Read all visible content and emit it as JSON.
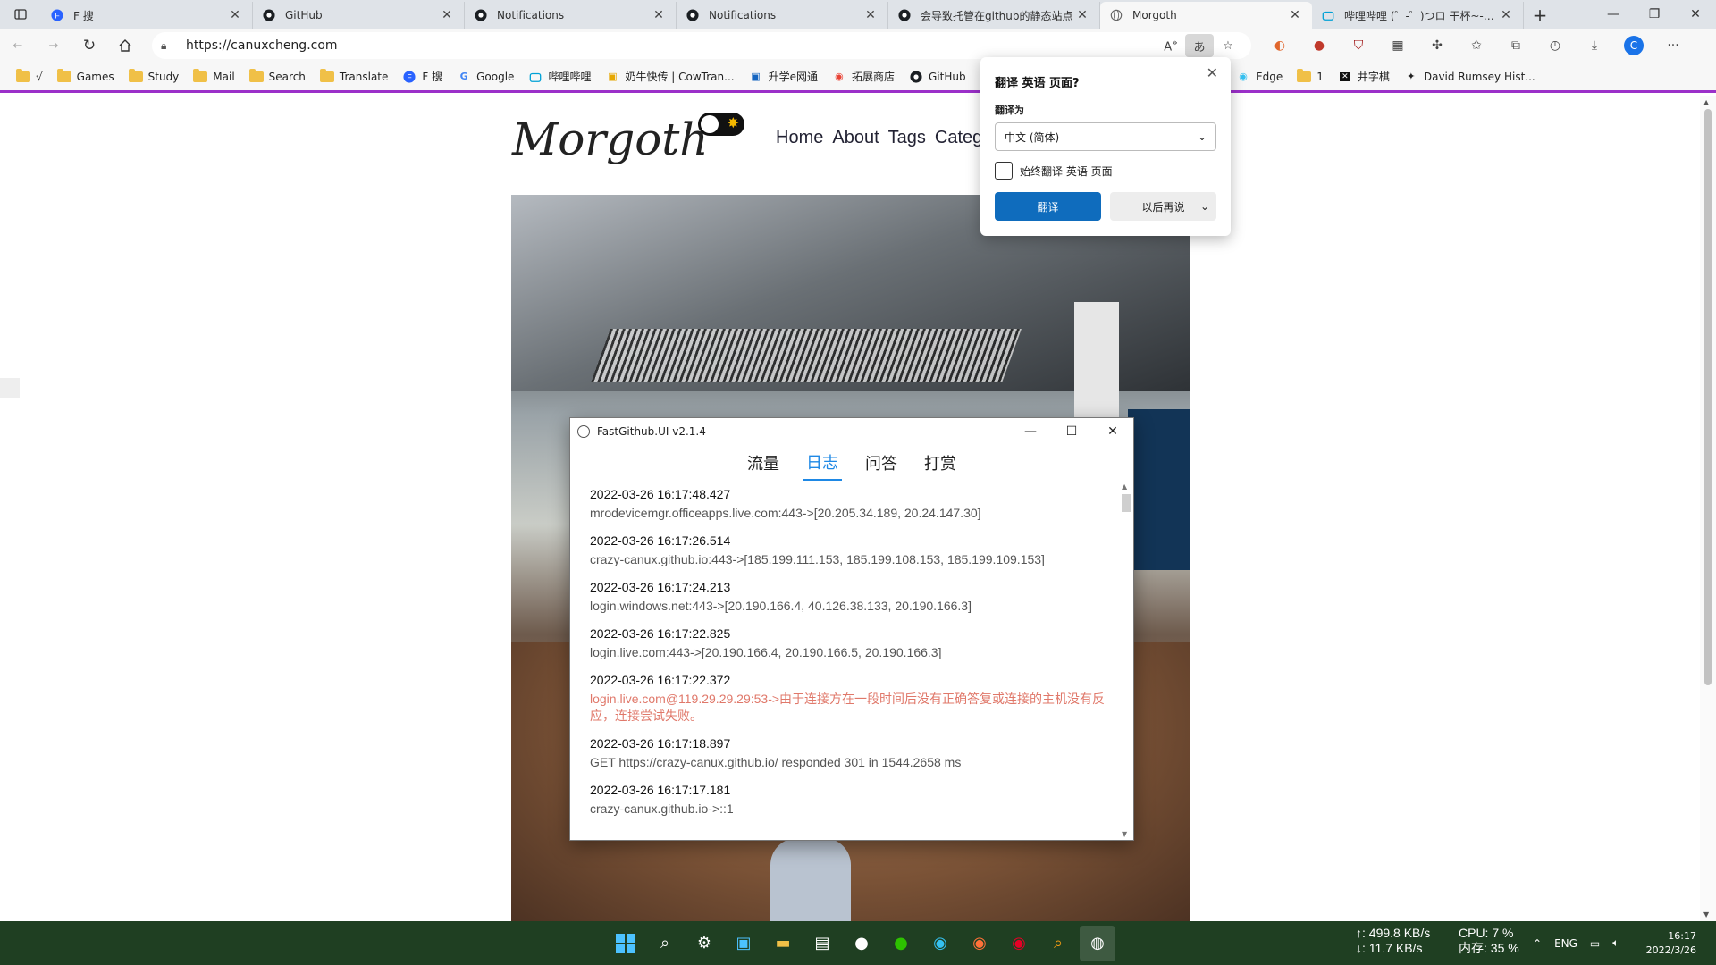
{
  "browser": {
    "tabs": [
      {
        "label": "F 搜",
        "icon": "f-search-icon",
        "active": false
      },
      {
        "label": "GitHub",
        "icon": "github-icon",
        "active": false
      },
      {
        "label": "Notifications",
        "icon": "github-icon",
        "active": false
      },
      {
        "label": "Notifications",
        "icon": "github-icon",
        "active": false
      },
      {
        "label": "会导致托管在github的静态站点",
        "icon": "github-icon",
        "active": false
      },
      {
        "label": "Morgoth",
        "icon": "globe-icon",
        "active": true
      },
      {
        "label": "哔哩哔哩 (゜-゜)つロ 干杯~-bili",
        "icon": "bilibili-icon",
        "active": false
      }
    ],
    "url": "https://canuxcheng.com",
    "bookmarks": [
      {
        "label": "√",
        "icon": "folder-icon"
      },
      {
        "label": "Games",
        "icon": "folder-icon"
      },
      {
        "label": "Study",
        "icon": "folder-icon"
      },
      {
        "label": "Mail",
        "icon": "folder-icon"
      },
      {
        "label": "Search",
        "icon": "folder-icon"
      },
      {
        "label": "Translate",
        "icon": "folder-icon"
      },
      {
        "label": "F 搜",
        "icon": "f-search-icon"
      },
      {
        "label": "Google",
        "icon": "google-icon"
      },
      {
        "label": "哔哩哔哩",
        "icon": "bilibili-icon"
      },
      {
        "label": "奶牛快传 | CowTran...",
        "icon": "cow-icon"
      },
      {
        "label": "升学e网通",
        "icon": "e-icon"
      },
      {
        "label": "拓展商店",
        "icon": "store-icon"
      },
      {
        "label": "GitHub",
        "icon": "github-icon"
      }
    ],
    "bookmarks_right": [
      {
        "label": "Edge",
        "icon": "edge-icon"
      },
      {
        "label": "1",
        "icon": "folder-icon"
      },
      {
        "label": "井字棋",
        "icon": "x-icon"
      },
      {
        "label": "David Rumsey Hist...",
        "icon": "star-icon"
      }
    ]
  },
  "site": {
    "logo": "Morgoth",
    "nav": [
      "Home",
      "About",
      "Tags",
      "Categ"
    ]
  },
  "translate_popup": {
    "title": "翻译 英语 页面?",
    "target_label": "翻译为",
    "target_value": "中文 (简体)",
    "always_label": "始终翻译 英语 页面",
    "translate_button": "翻译",
    "later_button": "以后再说"
  },
  "fastgithub": {
    "title": "FastGithub.UI v2.1.4",
    "tabs": [
      {
        "label": "流量",
        "active": false
      },
      {
        "label": "日志",
        "active": true
      },
      {
        "label": "问答",
        "active": false
      },
      {
        "label": "打赏",
        "active": false
      }
    ],
    "logs": [
      {
        "time": "2022-03-26 16:17:48.427",
        "msg": "mrodevicemgr.officeapps.live.com:443->[20.205.34.189, 20.24.147.30]",
        "error": false
      },
      {
        "time": "2022-03-26 16:17:26.514",
        "msg": "crazy-canux.github.io:443->[185.199.111.153, 185.199.108.153, 185.199.109.153]",
        "error": false
      },
      {
        "time": "2022-03-26 16:17:24.213",
        "msg": "login.windows.net:443->[20.190.166.4, 40.126.38.133, 20.190.166.3]",
        "error": false
      },
      {
        "time": "2022-03-26 16:17:22.825",
        "msg": "login.live.com:443->[20.190.166.4, 20.190.166.5, 20.190.166.3]",
        "error": false
      },
      {
        "time": "2022-03-26 16:17:22.372",
        "msg": "login.live.com@119.29.29.29:53->由于连接方在一段时间后没有正确答复或连接的主机没有反应，连接尝试失败。",
        "error": true
      },
      {
        "time": "2022-03-26 16:17:18.897",
        "msg": "GET https://crazy-canux.github.io/ responded 301 in 1544.2658 ms",
        "error": false
      },
      {
        "time": "2022-03-26 16:17:17.181",
        "msg": "crazy-canux.github.io->::1",
        "error": false
      }
    ]
  },
  "taskbar": {
    "net_up": "↑: 499.8 KB/s",
    "net_down": "↓: 11.7 KB/s",
    "cpu": "CPU: 7 %",
    "mem": "内存: 35 %",
    "lang": "ENG",
    "time": "16:17",
    "date": "2022/3/26"
  },
  "colors": {
    "accent": "#0f6cbd",
    "bookmark_border": "#9b30c9",
    "taskbar": "#1f3f22",
    "error_log": "#e0786a",
    "active_tab_blue": "#1e88e5"
  }
}
